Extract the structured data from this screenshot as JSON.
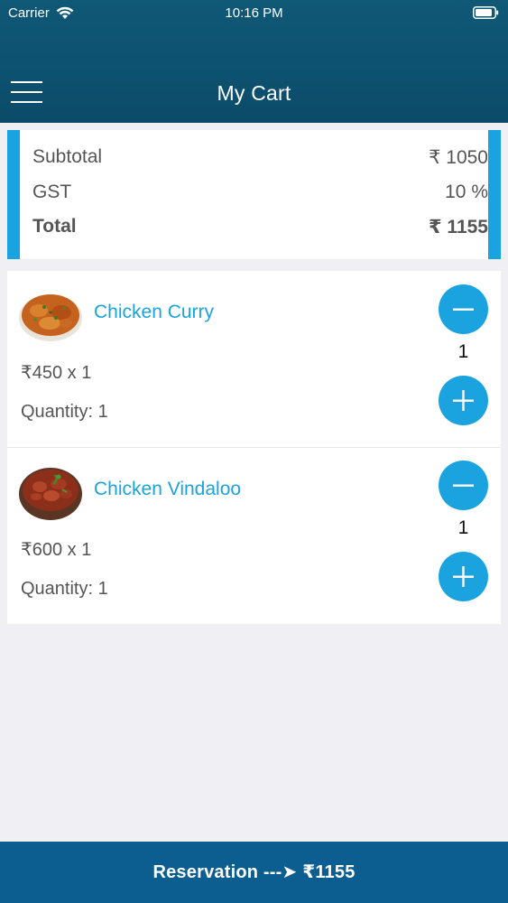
{
  "status_bar": {
    "carrier": "Carrier",
    "time": "10:16 PM",
    "icons": [
      "wifi-icon",
      "battery-icon"
    ]
  },
  "nav": {
    "title": "My Cart",
    "menu_icon": "hamburger-menu-icon"
  },
  "summary": {
    "subtotal_label": "Subtotal",
    "subtotal_value": "₹ 1050",
    "gst_label": "GST",
    "gst_value": "10 %",
    "total_label": "Total",
    "total_value": "₹ 1155"
  },
  "items": [
    {
      "name": "Chicken Curry",
      "price": "₹450 x 1",
      "quantity": "Quantity: 1",
      "count": "1",
      "image_icon": "chicken-curry-image"
    },
    {
      "name": "Chicken Vindaloo",
      "price": "₹600 x 1",
      "quantity": "Quantity: 1",
      "count": "1",
      "image_icon": "chicken-vindaloo-image"
    }
  ],
  "footer": {
    "label": "Reservation ---➤ ₹1155"
  },
  "colors": {
    "header": "#0d5170",
    "accent": "#1aa3de",
    "footer": "#0d5e90",
    "background": "#efeff4"
  }
}
